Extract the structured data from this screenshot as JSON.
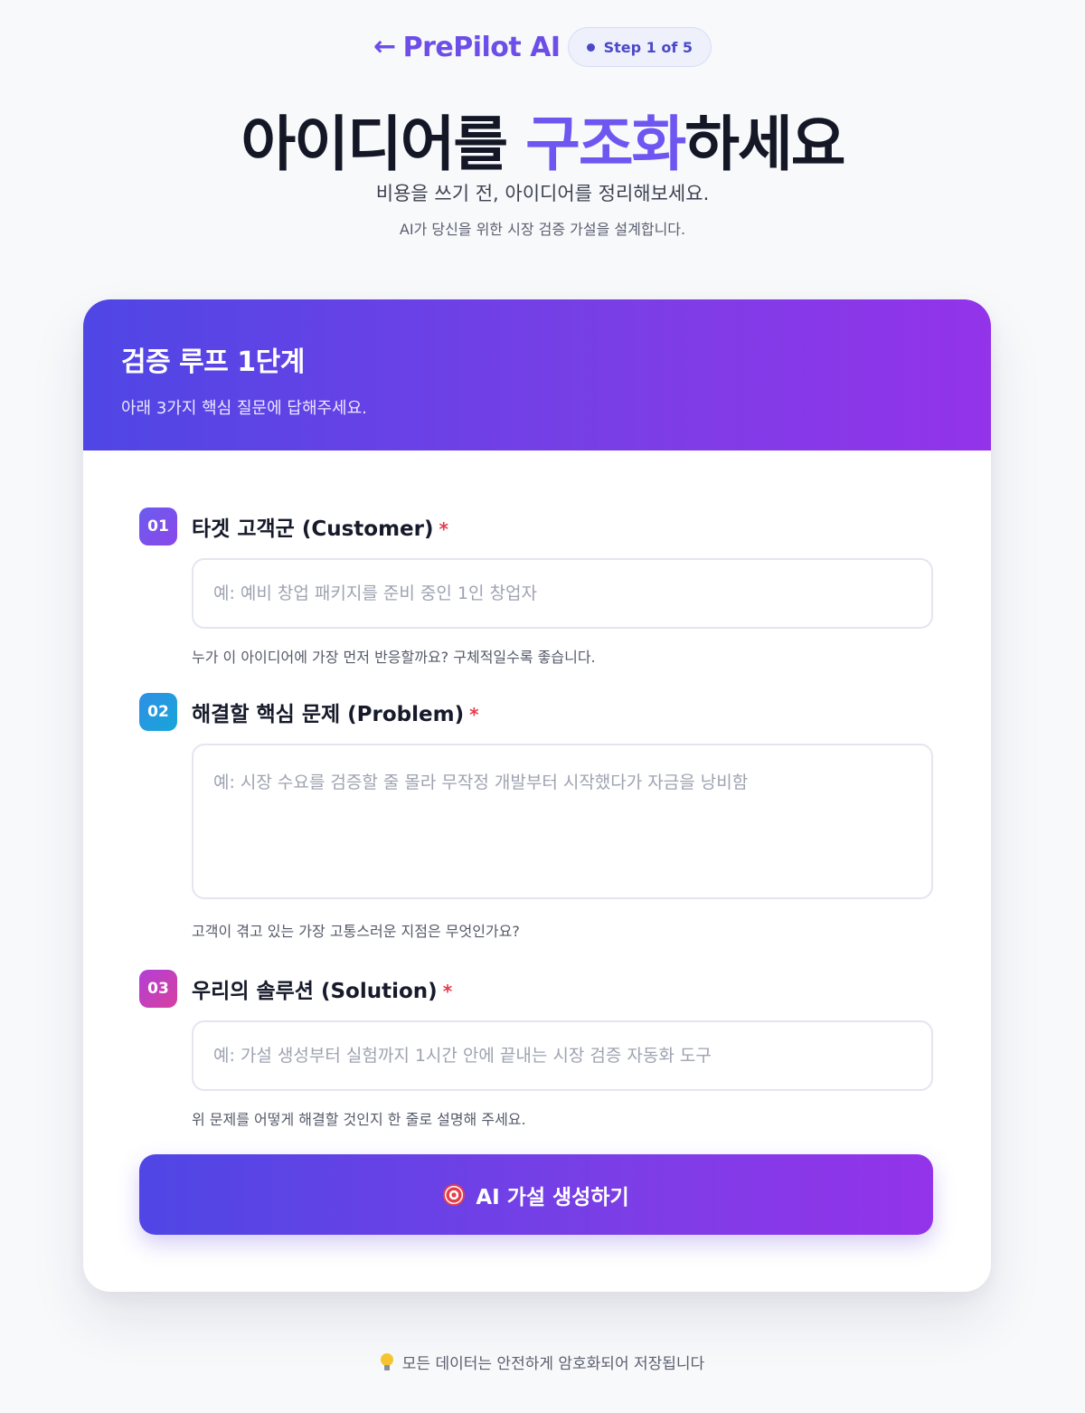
{
  "brand": {
    "back_arrow": "←",
    "name": "PrePilot AI",
    "step_label": "Step 1 of 5"
  },
  "hero": {
    "title_before": "아이디어를 ",
    "title_accent": "구조화",
    "title_after": "하세요",
    "subtitle": "비용을 쓰기 전, 아이디어를 정리해보세요.",
    "note": "AI가 당신을 위한 시장 검증 가설을 설계합니다."
  },
  "card": {
    "title": "검증 루프 1단계",
    "subtitle": "아래 3가지 핵심 질문에 답해주세요.",
    "fields": [
      {
        "number": "01",
        "label": "타겟 고객군 (Customer)",
        "required_mark": "*",
        "placeholder": "예: 예비 창업 패키지를 준비 중인 1인 창업자",
        "value": "",
        "hint": "누가 이 아이디어에 가장 먼저 반응할까요? 구체적일수록 좋습니다."
      },
      {
        "number": "02",
        "label": "해결할 핵심 문제 (Problem)",
        "required_mark": "*",
        "placeholder": "예: 시장 수요를 검증할 줄 몰라 무작정 개발부터 시작했다가 자금을 낭비함",
        "value": "",
        "hint": "고객이 겪고 있는 가장 고통스러운 지점은 무엇인가요?"
      },
      {
        "number": "03",
        "label": "우리의 솔루션 (Solution)",
        "required_mark": "*",
        "placeholder": "예: 가설 생성부터 실험까지 1시간 안에 끝내는 시장 검증 자동화 도구",
        "value": "",
        "hint": "위 문제를 어떻게 해결할 것인지 한 줄로 설명해 주세요."
      }
    ],
    "submit_label": "AI 가설 생성하기",
    "submit_icon": "target-icon"
  },
  "footer": {
    "icon": "lightbulb-icon",
    "text": "모든 데이터는 안전하게 암호화되어 저장됩니다"
  },
  "colors": {
    "accent": "#6f56f0",
    "gradient_start": "#4f46e5",
    "gradient_end": "#9333ea",
    "required": "#e53e4f"
  }
}
